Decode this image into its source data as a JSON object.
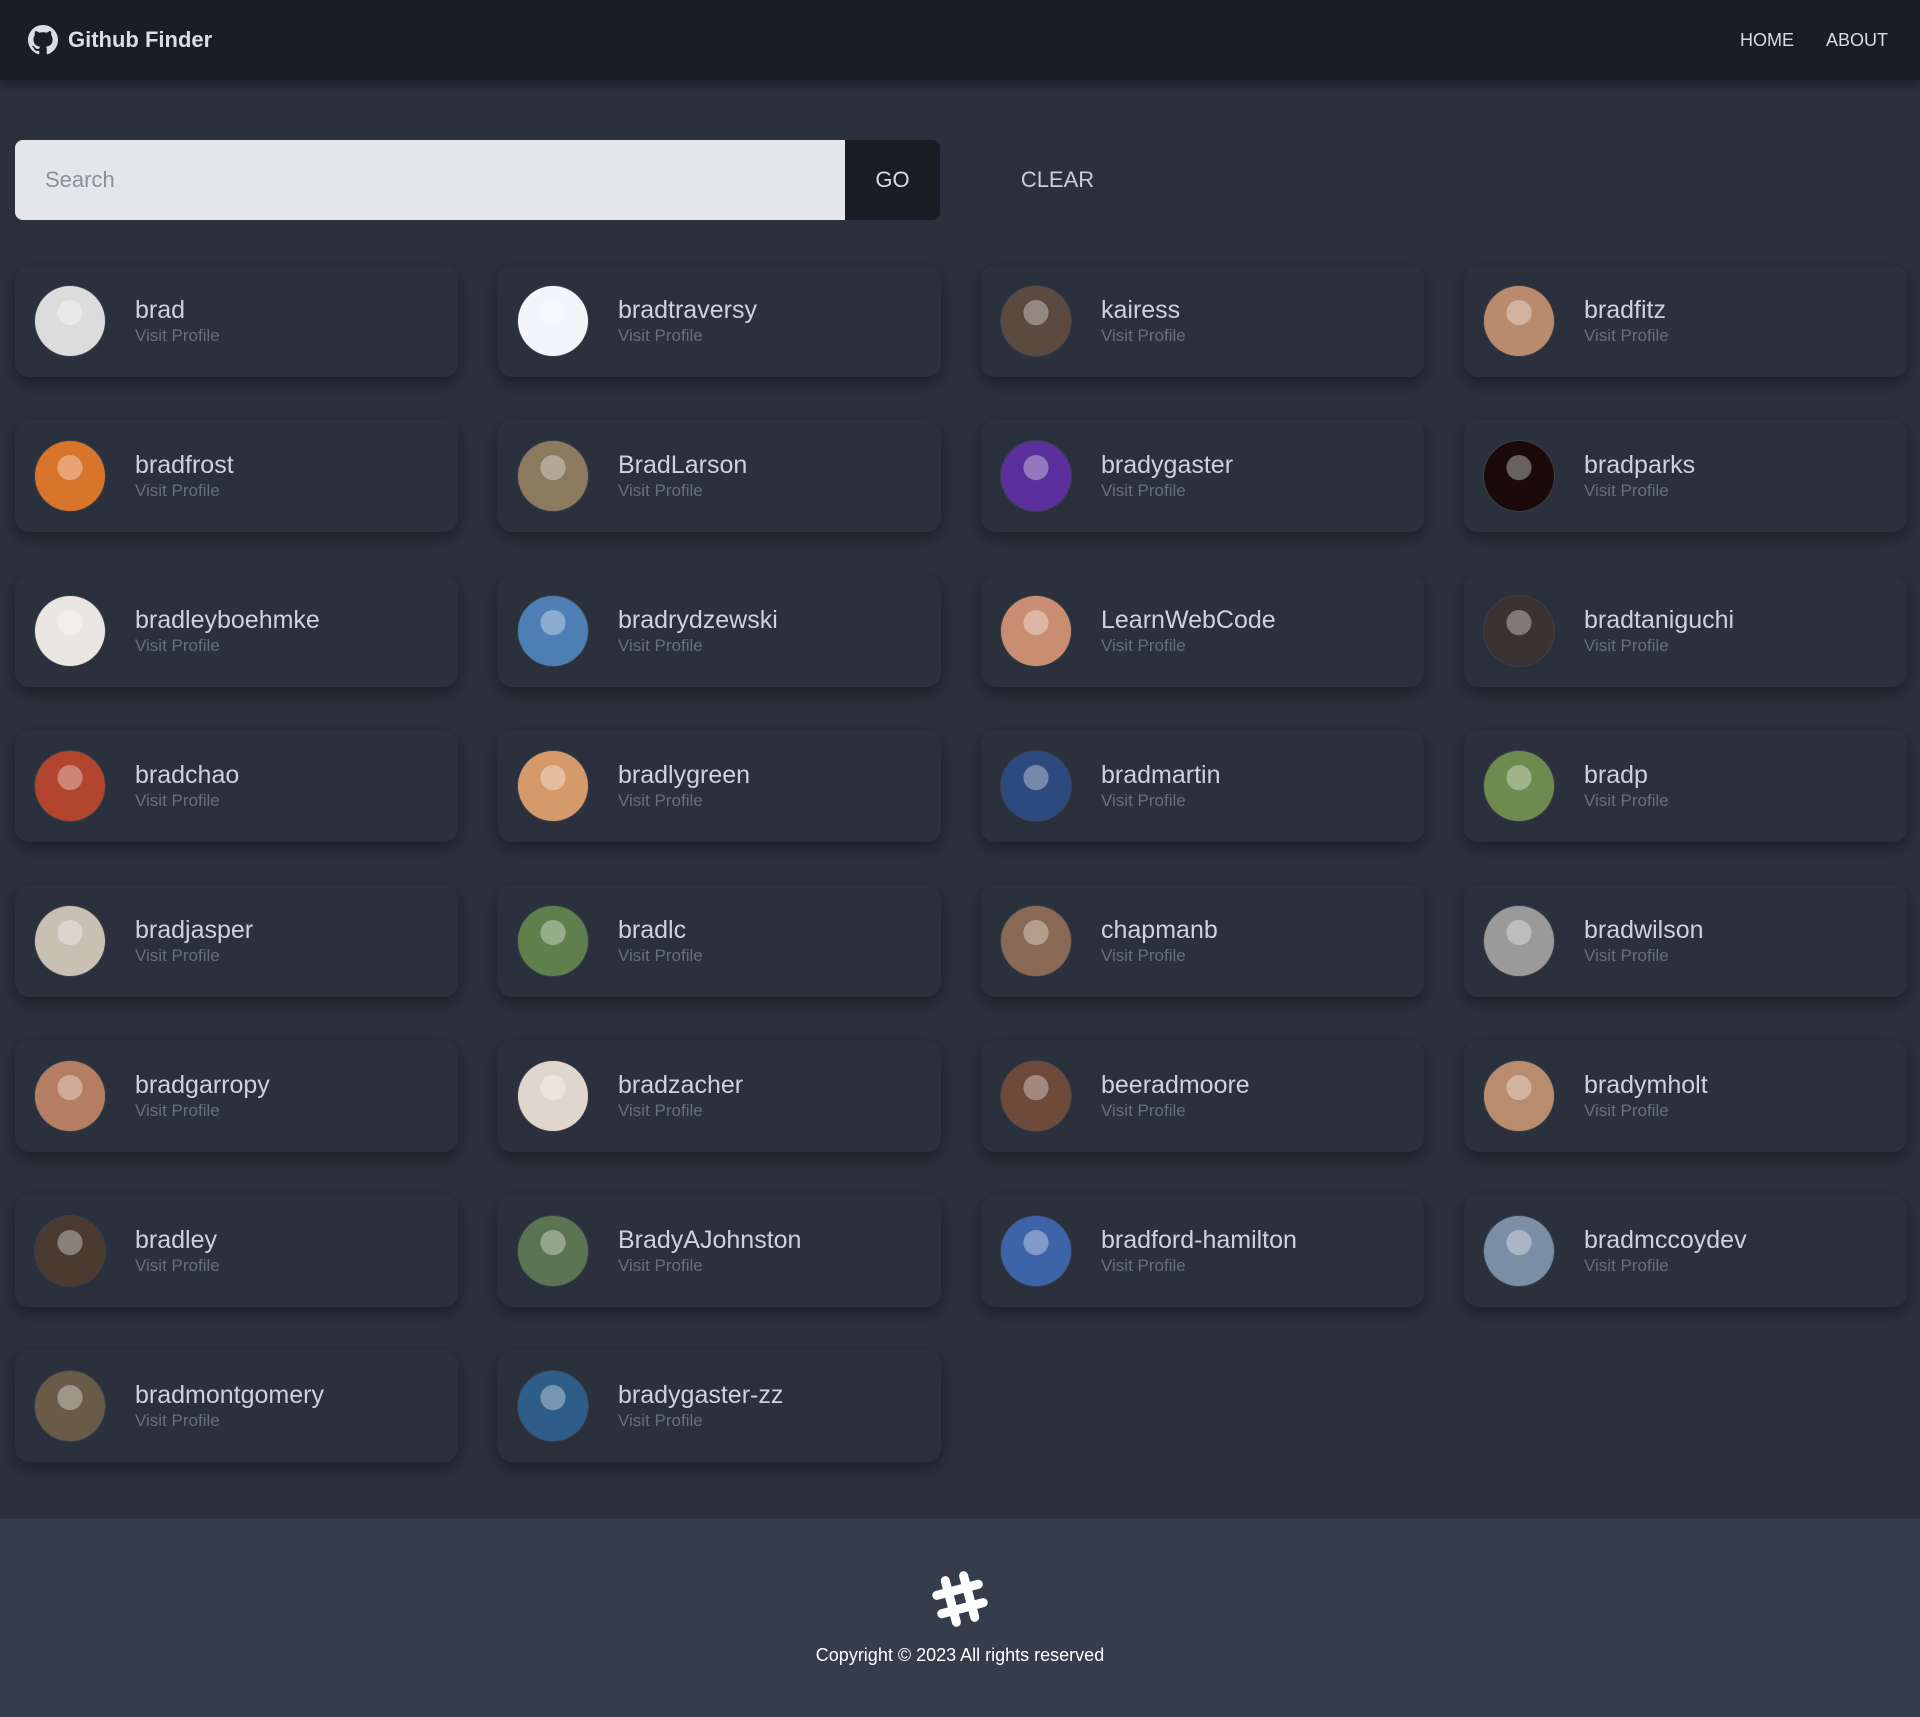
{
  "nav": {
    "brand": "Github Finder",
    "links": [
      "HOME",
      "ABOUT"
    ]
  },
  "search": {
    "placeholder": "Search",
    "go_label": "GO",
    "clear_label": "CLEAR"
  },
  "users": [
    {
      "login": "brad",
      "link": "Visit Profile",
      "color": "#dcdcdc"
    },
    {
      "login": "bradtraversy",
      "link": "Visit Profile",
      "color": "#f2f6fa"
    },
    {
      "login": "kairess",
      "link": "Visit Profile",
      "color": "#5a4a3f"
    },
    {
      "login": "bradfitz",
      "link": "Visit Profile",
      "color": "#b98b6d"
    },
    {
      "login": "bradfrost",
      "link": "Visit Profile",
      "color": "#d9742b"
    },
    {
      "login": "BradLarson",
      "link": "Visit Profile",
      "color": "#8b7a5e"
    },
    {
      "login": "bradygaster",
      "link": "Visit Profile",
      "color": "#5a2f9c"
    },
    {
      "login": "bradparks",
      "link": "Visit Profile",
      "color": "#1a0a0a"
    },
    {
      "login": "bradleyboehmke",
      "link": "Visit Profile",
      "color": "#e9e6e2"
    },
    {
      "login": "bradrydzewski",
      "link": "Visit Profile",
      "color": "#4d7fb5"
    },
    {
      "login": "LearnWebCode",
      "link": "Visit Profile",
      "color": "#c98e72"
    },
    {
      "login": "bradtaniguchi",
      "link": "Visit Profile",
      "color": "#3a3330"
    },
    {
      "login": "bradchao",
      "link": "Visit Profile",
      "color": "#b2452d"
    },
    {
      "login": "bradlygreen",
      "link": "Visit Profile",
      "color": "#d69a6a"
    },
    {
      "login": "bradmartin",
      "link": "Visit Profile",
      "color": "#2c4a7e"
    },
    {
      "login": "bradp",
      "link": "Visit Profile",
      "color": "#6f8a4e"
    },
    {
      "login": "bradjasper",
      "link": "Visit Profile",
      "color": "#c9bfb3"
    },
    {
      "login": "bradlc",
      "link": "Visit Profile",
      "color": "#5f7f4d"
    },
    {
      "login": "chapmanb",
      "link": "Visit Profile",
      "color": "#8a6a55"
    },
    {
      "login": "bradwilson",
      "link": "Visit Profile",
      "color": "#9a9a9a"
    },
    {
      "login": "bradgarropy",
      "link": "Visit Profile",
      "color": "#b57e63"
    },
    {
      "login": "bradzacher",
      "link": "Visit Profile",
      "color": "#e0d6ce"
    },
    {
      "login": "beeradmoore",
      "link": "Visit Profile",
      "color": "#6e4a3a"
    },
    {
      "login": "bradymholt",
      "link": "Visit Profile",
      "color": "#b88c6d"
    },
    {
      "login": "bradley",
      "link": "Visit Profile",
      "color": "#4a3a30"
    },
    {
      "login": "BradyAJohnston",
      "link": "Visit Profile",
      "color": "#5b7552"
    },
    {
      "login": "bradford-hamilton",
      "link": "Visit Profile",
      "color": "#3d63a8"
    },
    {
      "login": "bradmccoydev",
      "link": "Visit Profile",
      "color": "#7a8fa6"
    },
    {
      "login": "bradmontgomery",
      "link": "Visit Profile",
      "color": "#6a5a48"
    },
    {
      "login": "bradygaster-zz",
      "link": "Visit Profile",
      "color": "#2f5d8a"
    }
  ],
  "footer": {
    "copyright": "Copyright © 2023 All rights reserved",
    "logo_icon": "hashtag-icon"
  }
}
